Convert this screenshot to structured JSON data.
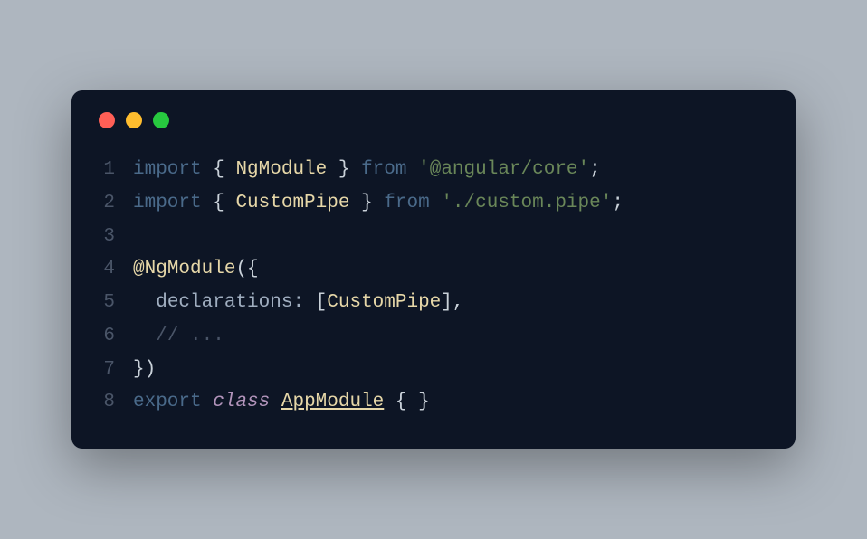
{
  "trafficLights": {
    "red": "close",
    "yellow": "minimize",
    "green": "maximize"
  },
  "lines": [
    {
      "num": "1"
    },
    {
      "num": "2"
    },
    {
      "num": "3"
    },
    {
      "num": "4"
    },
    {
      "num": "5"
    },
    {
      "num": "6"
    },
    {
      "num": "7"
    },
    {
      "num": "8"
    }
  ],
  "code": {
    "l1": {
      "import": "import",
      "ob": " { ",
      "ng": "NgModule",
      "cb": " } ",
      "from": "from",
      "sp": " ",
      "str": "'@angular/core'",
      "semi": ";"
    },
    "l2": {
      "import": "import",
      "ob": " { ",
      "cp": "CustomPipe",
      "cb": " } ",
      "from": "from",
      "sp": " ",
      "str": "'./custom.pipe'",
      "semi": ";"
    },
    "l3": "",
    "l4": {
      "at": "@",
      "ng": "NgModule",
      "paren": "({"
    },
    "l5": {
      "indent": "  ",
      "decl": "declarations: ",
      "ob": "[",
      "cp": "CustomPipe",
      "cb": "],"
    },
    "l6": {
      "indent": "  ",
      "comment": "// ..."
    },
    "l7": {
      "paren": "})"
    },
    "l8": {
      "export": "export",
      "sp1": " ",
      "class": "class",
      "sp2": " ",
      "name": "AppModule",
      "sp3": " ",
      "braces": "{ }"
    }
  }
}
